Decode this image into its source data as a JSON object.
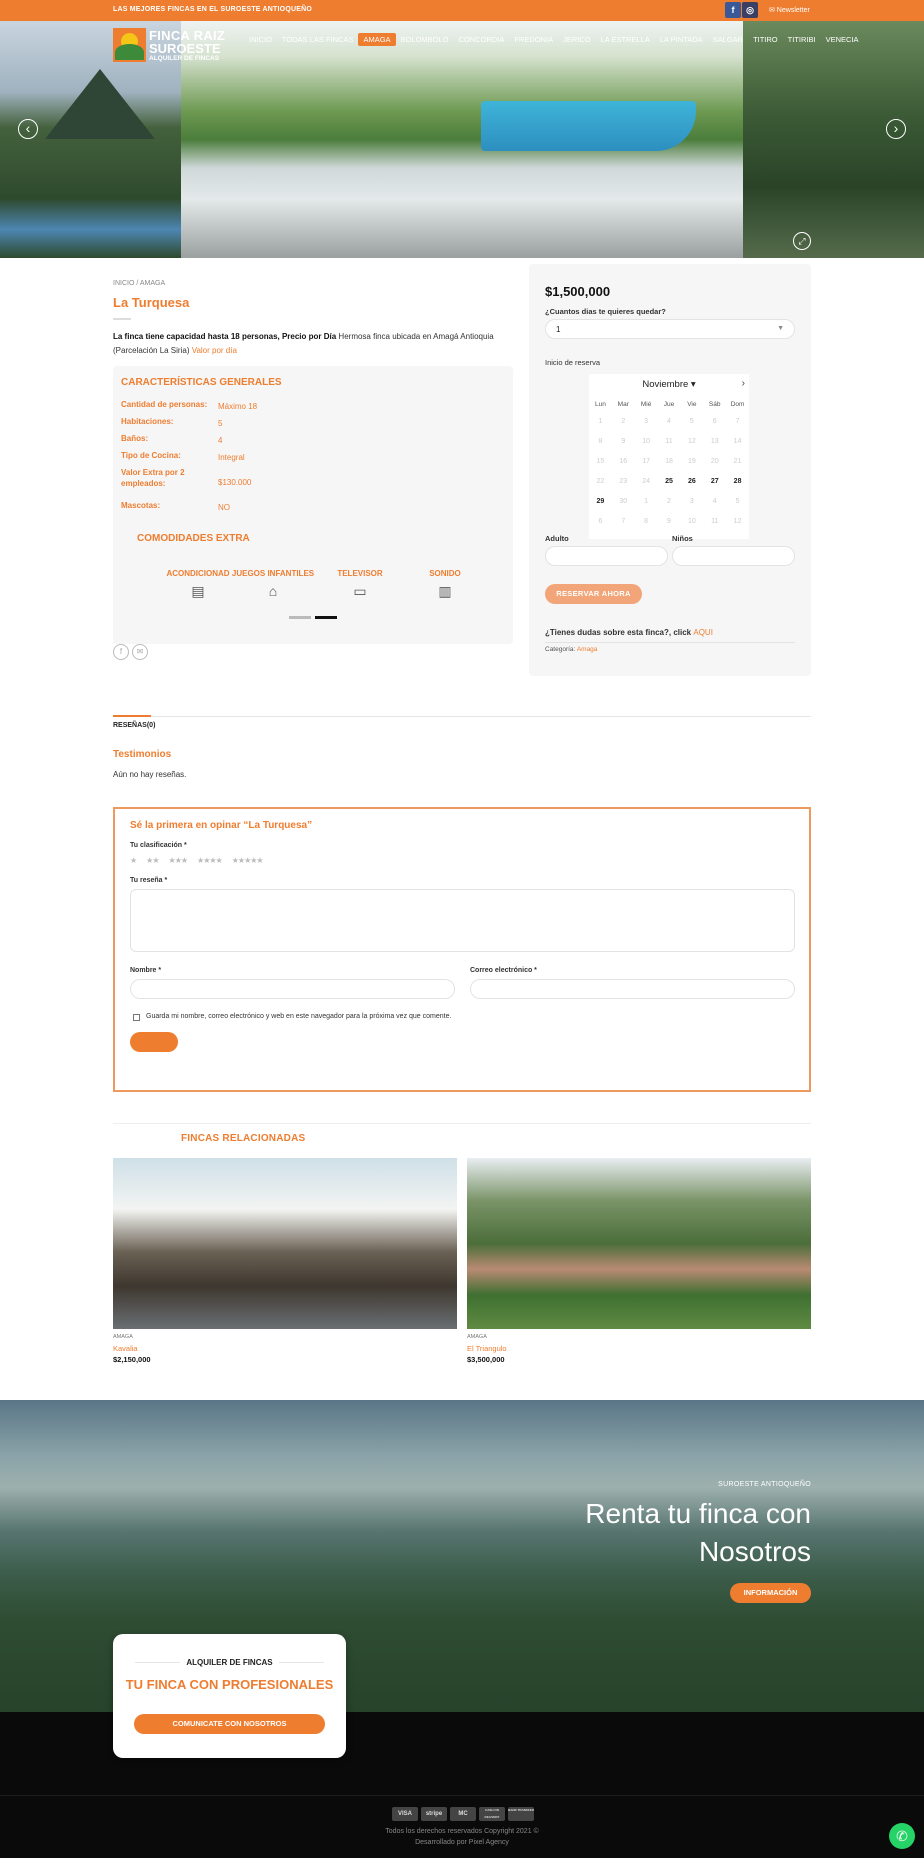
{
  "topbar": {
    "promo": "LAS MEJORES FINCAS EN EL SUROESTE ANTIOQUEÑO",
    "facebook": "f",
    "instagram": "◎",
    "newsletter": "✉ Newsletter"
  },
  "logo": {
    "line1": "FINCA RAIZ",
    "line2": "SUROESTE",
    "line3": "ALQUILER DE FINCAS"
  },
  "nav": {
    "items": [
      "INICIO",
      "TODAS LAS FINCAS",
      "AMAGA",
      "BOLOMBOLO",
      "CONCORDIA",
      "FREDONIA",
      "JERICO",
      "LA ESTRELLA",
      "LA PINTADA",
      "SALGAR",
      "TITIRO",
      "TITIRIBI",
      "VENECIA"
    ],
    "active_index": 2
  },
  "hero": {
    "prev": "‹",
    "next": "›",
    "zoom": "⤢"
  },
  "product": {
    "breadcrumb": "INICIO  /  AMAGA",
    "title": "La Turquesa",
    "desc_bold": "La finca tiene capacidad hasta 18 personas, Precio por Día",
    "desc_rest": " Hermosa finca ubicada en Amagá Antioquia (Parcelación La Siria) ",
    "desc_link": "Valor por día"
  },
  "specs": {
    "title": "CARACTERÍSTICAS GENERALES",
    "rows": [
      {
        "k": "Cantidad de personas:",
        "v": "Máximo 18"
      },
      {
        "k": "Habitaciones:",
        "v": "5"
      },
      {
        "k": "Baños:",
        "v": "4"
      },
      {
        "k": "Tipo de Cocina:",
        "v": "Integral"
      },
      {
        "k": "Valor Extra por 2 empleados:",
        "v": "$130.000"
      },
      {
        "k": "Mascotas:",
        "v": "NO"
      }
    ],
    "extra_title": "COMODIDADES EXTRA",
    "amenities": [
      {
        "label": "ACONDICIONAD",
        "icon": "air-conditioner-icon",
        "glyph": "▤"
      },
      {
        "label": "JUEGOS INFANTILES",
        "icon": "playground-icon",
        "glyph": "⌂"
      },
      {
        "label": "TELEVISOR",
        "icon": "tv-icon",
        "glyph": "▭"
      },
      {
        "label": "SONIDO",
        "icon": "speaker-icon",
        "glyph": "▥"
      }
    ]
  },
  "share": {
    "facebook": "f",
    "email": "✉"
  },
  "booking": {
    "price": "$1,500,000",
    "days_label": "¿Cuantos dias te quieres quedar?",
    "days_value": "1",
    "date_label": "Inicio de reserva",
    "month": "Noviembre ▾",
    "next": "›",
    "weekdays": [
      "Lun",
      "Mar",
      "Mié",
      "Jue",
      "Vie",
      "Sáb",
      "Dom"
    ],
    "days": [
      "1",
      "2",
      "3",
      "4",
      "5",
      "6",
      "7",
      "8",
      "9",
      "10",
      "11",
      "12",
      "13",
      "14",
      "15",
      "16",
      "17",
      "18",
      "19",
      "20",
      "21",
      "22",
      "23",
      "24",
      "25",
      "26",
      "27",
      "28",
      "29",
      "30",
      "1",
      "2",
      "3",
      "4",
      "5",
      "6",
      "7",
      "8",
      "9",
      "10",
      "11",
      "12"
    ],
    "enabled_days": [
      25,
      26,
      27,
      28,
      29
    ],
    "adult_label": "Adulto",
    "kids_label": "Niños",
    "reserve_btn": "RESERVAR AHORA",
    "doubt_text": "¿Tienes dudas sobre esta finca?, click ",
    "doubt_link": "AQUI",
    "category_label": "Categoría: ",
    "category_value": "Amaga"
  },
  "reviews": {
    "tab": "RESEÑAS(0)",
    "title": "Testimonios",
    "none": "Aún no hay reseñas.",
    "form_title": "Sé la primera en opinar “La Turquesa”",
    "rating_label": "Tu clasificación *",
    "stars": [
      "★",
      "★★",
      "★★★",
      "★★★★",
      "★★★★★"
    ],
    "review_label": "Tu reseña *",
    "name_label": "Nombre *",
    "email_label": "Correo electrónico *",
    "save_label": "Guarda mi nombre, correo electrónico y web en este navegador para la próxima vez que comente."
  },
  "related": {
    "title": "FINCAS RELACIONADAS",
    "items": [
      {
        "cat": "AMAGA",
        "name": "Kavalia",
        "price": "$2,150,000"
      },
      {
        "cat": "AMAGA",
        "name": "El Triangulo",
        "price": "$3,500,000"
      }
    ]
  },
  "banner": {
    "sub": "SUROESTE ANTIOQUEÑO",
    "headline": "Renta tu finca con Nosotros",
    "button": "INFORMACIÓN"
  },
  "card": {
    "kicker": "ALQUILER DE FINCAS",
    "headline": "TU FINCA CON PROFESIONALES",
    "button": "COMUNICATE CON NOSOTROS"
  },
  "footer": {
    "payments": [
      "VISA",
      "stripe",
      "MC",
      "CASH ON DELIVERY",
      "BANK TRANSFER"
    ],
    "copyright": "Todos los derechos reservados Copyright 2021 ©",
    "credit": "Desarrollado por Pixel Agency"
  },
  "whatsapp": "✆"
}
